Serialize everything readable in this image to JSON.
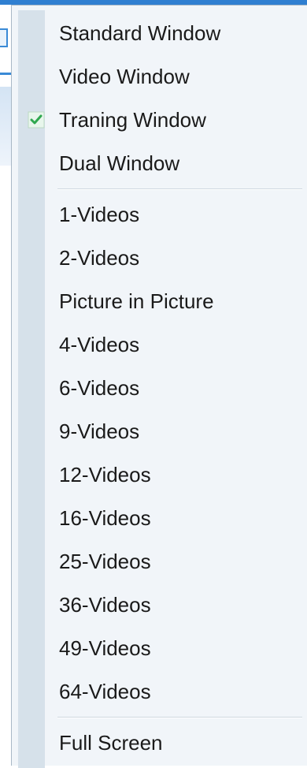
{
  "menu": {
    "group1": [
      {
        "label": "Standard Window",
        "checked": false
      },
      {
        "label": "Video Window",
        "checked": false
      },
      {
        "label": "Traning Window",
        "checked": true
      },
      {
        "label": "Dual Window",
        "checked": false
      }
    ],
    "group2": [
      {
        "label": "1-Videos"
      },
      {
        "label": "2-Videos"
      },
      {
        "label": "Picture in Picture"
      },
      {
        "label": "4-Videos"
      },
      {
        "label": "6-Videos"
      },
      {
        "label": "9-Videos"
      },
      {
        "label": "12-Videos"
      },
      {
        "label": "16-Videos"
      },
      {
        "label": "25-Videos"
      },
      {
        "label": "36-Videos"
      },
      {
        "label": "49-Videos"
      },
      {
        "label": "64-Videos"
      }
    ],
    "group3": [
      {
        "label": "Full Screen"
      }
    ],
    "check_icon": "checkmark-icon",
    "check_color": "#2fa84f"
  }
}
